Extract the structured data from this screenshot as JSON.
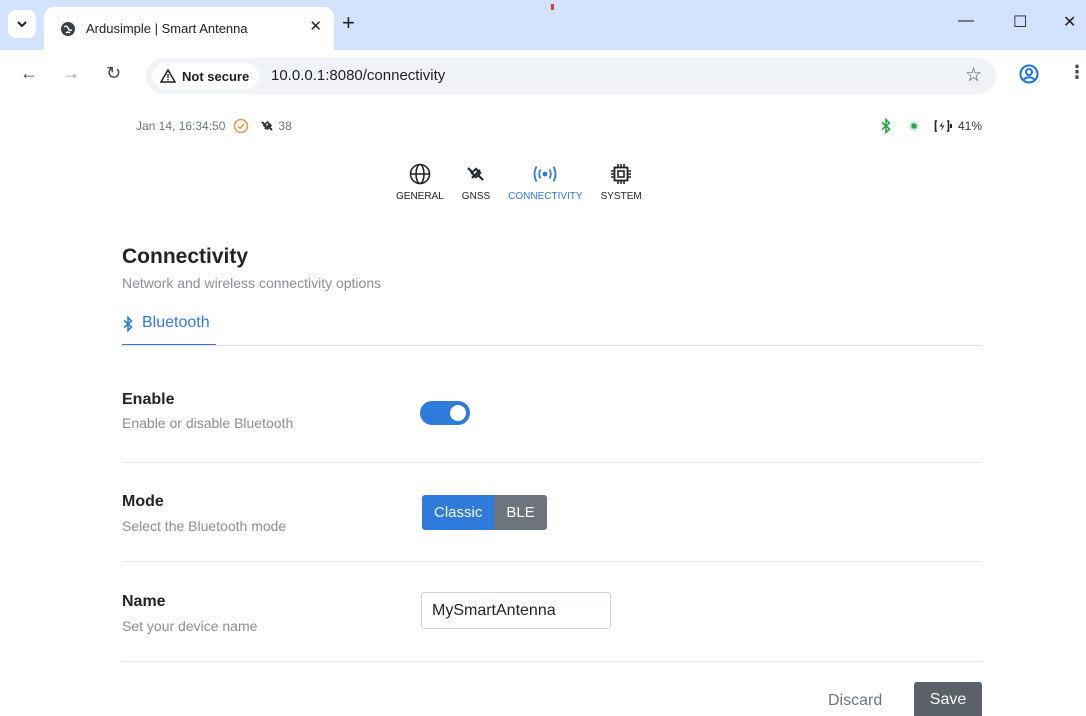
{
  "browser": {
    "tab_title": "Ardusimple | Smart Antenna",
    "security_label": "Not secure",
    "url": "10.0.0.1:8080/connectivity"
  },
  "status": {
    "datetime": "Jan 14, 16:34:50",
    "satellites": "38",
    "battery": "41%"
  },
  "nav": {
    "items": [
      {
        "label": "GENERAL",
        "icon": "globe-icon"
      },
      {
        "label": "GNSS",
        "icon": "satellite-icon"
      },
      {
        "label": "CONNECTIVITY",
        "icon": "wireless-icon",
        "active": true
      },
      {
        "label": "SYSTEM",
        "icon": "chip-icon"
      }
    ]
  },
  "page": {
    "title": "Connectivity",
    "subtitle": "Network and wireless connectivity options",
    "tab": "Bluetooth"
  },
  "settings": {
    "enable": {
      "title": "Enable",
      "desc": "Enable or disable Bluetooth",
      "value": true
    },
    "mode": {
      "title": "Mode",
      "desc": "Select the Bluetooth mode",
      "options": [
        "Classic",
        "BLE"
      ],
      "selected": "Classic"
    },
    "name": {
      "title": "Name",
      "desc": "Set your device name",
      "value": "MySmartAntenna"
    }
  },
  "actions": {
    "discard": "Discard",
    "save": "Save"
  },
  "colors": {
    "accent": "#2e7bdc",
    "secondary": "#6c757d",
    "success": "#28a745"
  }
}
